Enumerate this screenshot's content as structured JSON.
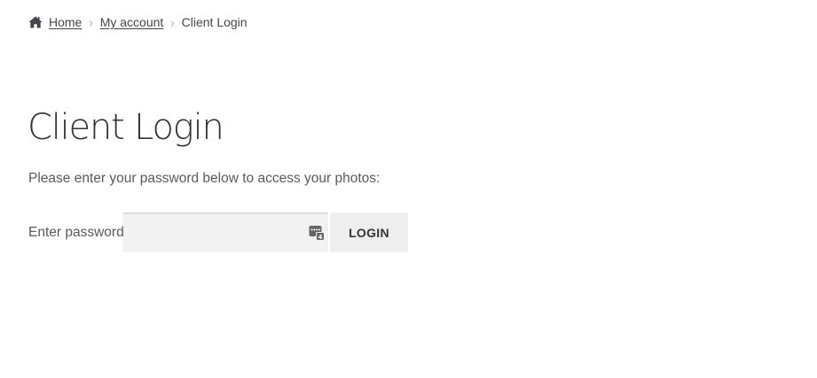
{
  "breadcrumb": {
    "home_icon": "home-icon",
    "items": [
      "Home",
      "My account"
    ],
    "current": "Client Login"
  },
  "page": {
    "title": "Client Login",
    "intro": "Please enter your password below to access your photos:"
  },
  "form": {
    "password_label": "Enter password",
    "password_value": "",
    "password_manager_icon": "password-manager-icon",
    "submit_label": "LOGIN"
  },
  "colors": {
    "text": "#43454b",
    "title": "#333333",
    "field_bg": "#f2f2f2",
    "button_bg": "#eeeeee",
    "separator": "#a9a9a9"
  }
}
